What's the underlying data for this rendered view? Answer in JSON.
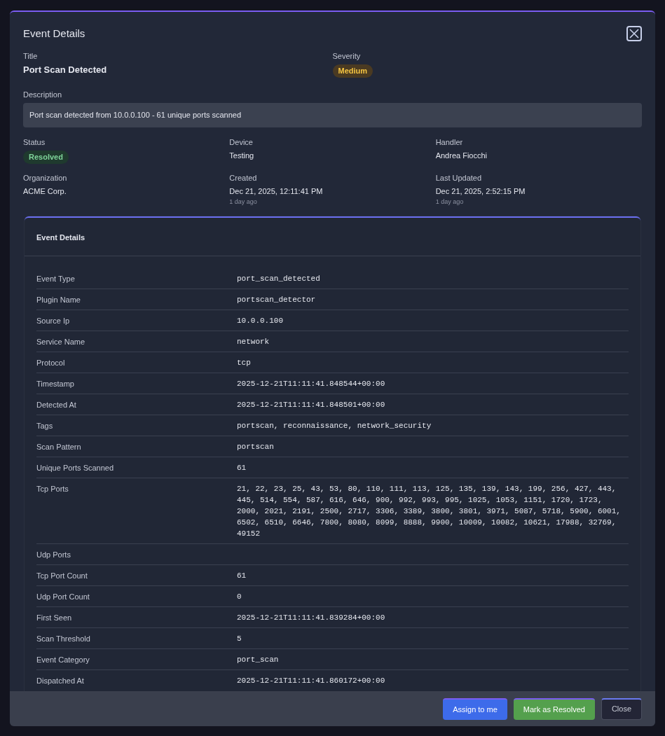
{
  "dialog": {
    "title": "Event Details"
  },
  "summary": {
    "title_label": "Title",
    "title": "Port Scan Detected",
    "severity_label": "Severity",
    "severity": {
      "label": "Medium",
      "kind": "medium"
    },
    "description_label": "Description",
    "description": "Port scan detected from 10.0.0.100 - 61 unique ports scanned"
  },
  "fields": [
    {
      "label": "Status",
      "badge": {
        "label": "Resolved",
        "kind": "resolved"
      }
    },
    {
      "label": "Device",
      "value": "Testing"
    },
    {
      "label": "Handler",
      "value": "Andrea Fiocchi"
    },
    {
      "label": "Organization",
      "value": "ACME Corp."
    },
    {
      "label": "Created",
      "value": "Dec 21, 2025, 12:11:41 PM",
      "note": "1 day ago"
    },
    {
      "label": "Last Updated",
      "value": "Dec 21, 2025, 2:52:15 PM",
      "note": "1 day ago"
    }
  ],
  "details": {
    "title": "Event Details",
    "rows": [
      {
        "label": "Event Type",
        "value": "port_scan_detected"
      },
      {
        "label": "Plugin Name",
        "value": "portscan_detector"
      },
      {
        "label": "Source Ip",
        "value": "10.0.0.100"
      },
      {
        "label": "Service Name",
        "value": "network"
      },
      {
        "label": "Protocol",
        "value": "tcp"
      },
      {
        "label": "Timestamp",
        "value": "2025-12-21T11:11:41.848544+00:00"
      },
      {
        "label": "Detected At",
        "value": "2025-12-21T11:11:41.848501+00:00"
      },
      {
        "label": "Tags",
        "value": "portscan, reconnaissance, network_security"
      },
      {
        "label": "Scan Pattern",
        "value": "portscan"
      },
      {
        "label": "Unique Ports Scanned",
        "value": "61"
      },
      {
        "label": "Tcp Ports",
        "value": "21, 22, 23, 25, 43, 53, 80, 110, 111, 113, 125, 135, 139, 143, 199, 256, 427, 443, 445, 514, 554, 587, 616, 646, 900, 992, 993, 995, 1025, 1053, 1151, 1720, 1723, 2000, 2021, 2191, 2500, 2717, 3306, 3389, 3800, 3801, 3971, 5087, 5718, 5900, 6001, 6502, 6510, 6646, 7800, 8080, 8099, 8888, 9900, 10009, 10082, 10621, 17988, 32769, 49152"
      },
      {
        "label": "Udp Ports"
      },
      {
        "label": "Tcp Port Count",
        "value": "61"
      },
      {
        "label": "Udp Port Count",
        "value": "0"
      },
      {
        "label": "First Seen",
        "value": "2025-12-21T11:11:41.839284+00:00"
      },
      {
        "label": "Scan Threshold",
        "value": "5"
      },
      {
        "label": "Event Category",
        "value": "port_scan"
      },
      {
        "label": "Dispatched At",
        "value": "2025-12-21T11:11:41.860172+00:00"
      }
    ]
  },
  "buttons": [
    {
      "label": "Assign to me",
      "kind": "primary"
    },
    {
      "label": "Mark as Resolved",
      "kind": "success"
    },
    {
      "label": "Close",
      "kind": "secondary"
    }
  ]
}
